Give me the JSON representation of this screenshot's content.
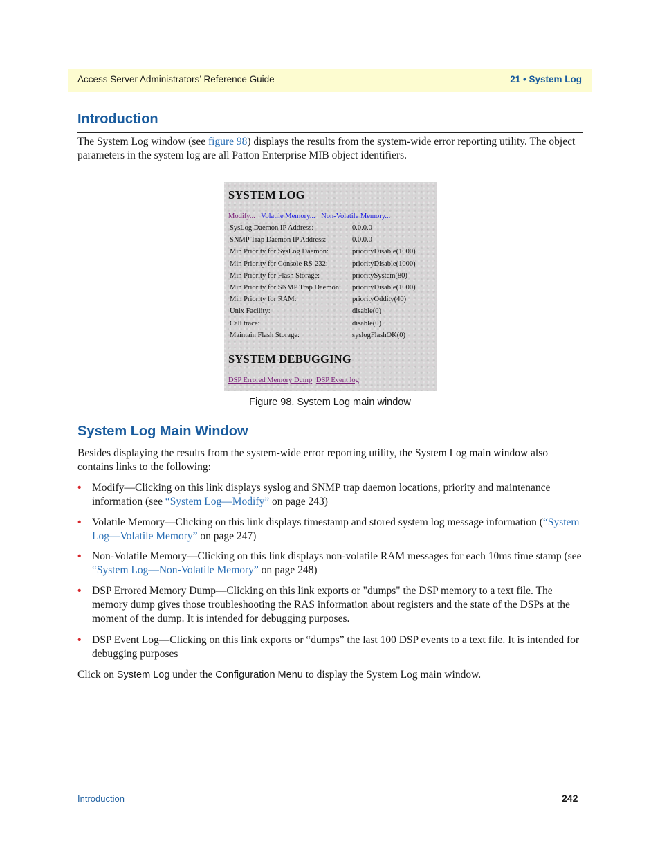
{
  "header": {
    "guide_title": "Access Server Administrators’ Reference Guide",
    "chapter": "21 • System Log"
  },
  "intro": {
    "heading": "Introduction",
    "para_before_link": "The System Log window (see ",
    "figure_link": "figure 98",
    "para_after_link": ") displays the results from the system-wide error reporting utility. The object parameters in the system log are all Patton Enterprise MIB object identifiers."
  },
  "figure": {
    "title": "SYSTEM LOG",
    "links": [
      {
        "label": "Modify...",
        "state": "visited"
      },
      {
        "label": "Volatile Memory...",
        "state": "unvisited"
      },
      {
        "label": "Non-Volatile Memory...",
        "state": "unvisited"
      }
    ],
    "rows": [
      {
        "label": "SysLog Daemon IP Address:",
        "value": "0.0.0.0"
      },
      {
        "label": "SNMP Trap Daemon IP Address:",
        "value": "0.0.0.0"
      },
      {
        "label": "Min Priority for SysLog Daemon:",
        "value": "priorityDisable(1000)"
      },
      {
        "label": "Min Priority for Console RS-232:",
        "value": "priorityDisable(1000)"
      },
      {
        "label": "Min Priority for Flash Storage:",
        "value": "prioritySystem(80)"
      },
      {
        "label": "Min Priority for SNMP Trap Daemon:",
        "value": "priorityDisable(1000)"
      },
      {
        "label": "Min Priority for RAM:",
        "value": "priorityOddity(40)"
      },
      {
        "label": "Unix Facility:",
        "value": "disable(0)"
      },
      {
        "label": "Call trace:",
        "value": "disable(0)"
      },
      {
        "label": "Maintain Flash Storage:",
        "value": "syslogFlashOK(0)"
      }
    ],
    "debug_title": "SYSTEM DEBUGGING",
    "debug_links": [
      "DSP Errored Memory Dump",
      "DSP Event log"
    ],
    "caption": "Figure 98. System Log main window"
  },
  "main_window": {
    "heading": "System Log Main Window",
    "intro": "Besides displaying the results from the system-wide error reporting utility, the System Log main window also contains links to the following:",
    "bullets": [
      {
        "before": "Modify—Clicking on this link displays syslog and SNMP trap daemon locations, priority and maintenance information (see ",
        "link": "“System Log—Modify”",
        "after": " on page 243)"
      },
      {
        "before": "Volatile Memory—Clicking on this link displays timestamp and stored system log message information (",
        "link": "“System Log—Volatile Memory”",
        "after": " on page 247)"
      },
      {
        "before": "Non-Volatile Memory—Clicking on this link displays non-volatile RAM messages for each 10ms time stamp (see ",
        "link": "“System Log—Non-Volatile Memory”",
        "after": " on page 248)"
      },
      {
        "before": "DSP Errored Memory Dump—Clicking on this link exports or \"dumps\" the DSP memory to a text file. The memory dump gives those troubleshooting the RAS information about registers and the state of the DSPs at the moment of the dump. It is intended for debugging purposes.",
        "link": "",
        "after": ""
      },
      {
        "before": "DSP Event Log—Clicking on this link exports or “dumps” the last 100 DSP events to a text file. It is intended for debugging purposes",
        "link": "",
        "after": ""
      }
    ],
    "closing": {
      "t1": "Click on ",
      "ui1": "System Log",
      "t2": " under the ",
      "ui2": "Configuration Menu",
      "t3": " to display the System Log main window."
    }
  },
  "footer": {
    "section": "Introduction",
    "page": "242"
  }
}
